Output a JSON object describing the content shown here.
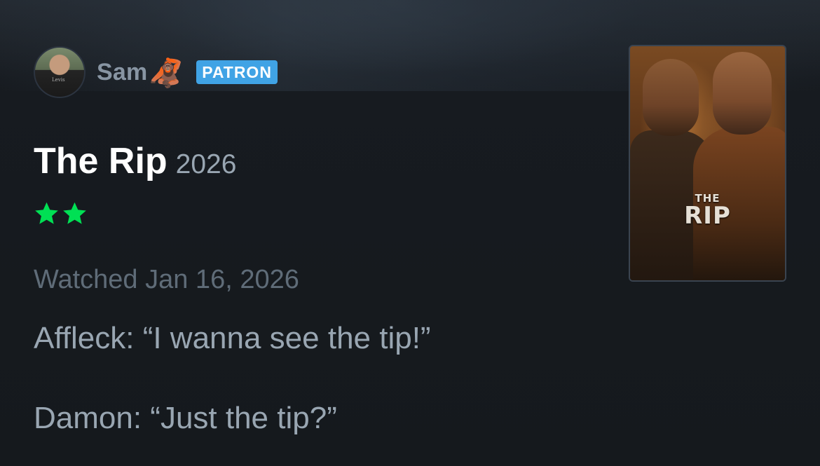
{
  "user": {
    "name": "Sam",
    "emoji": "🦧",
    "badge": "PATRON",
    "avatar_shirt_text": "Levis"
  },
  "film": {
    "title": "The Rip",
    "year": "2026",
    "rating_stars": 2,
    "rating_max": 5,
    "star_color": "#00e054"
  },
  "watched": "Watched Jan 16, 2026",
  "review": {
    "paragraphs": [
      "Affleck: “I wanna see the tip!”",
      "Damon: “Just the tip?”"
    ]
  },
  "poster": {
    "logo_line1": "THE",
    "logo_line2": "RIP"
  },
  "colors": {
    "background": "#14181c",
    "badge": "#40a3e5",
    "title": "#ffffff",
    "muted_text": "#99a6b2",
    "meta_text": "#5f6c78",
    "username": "#8895a3"
  }
}
